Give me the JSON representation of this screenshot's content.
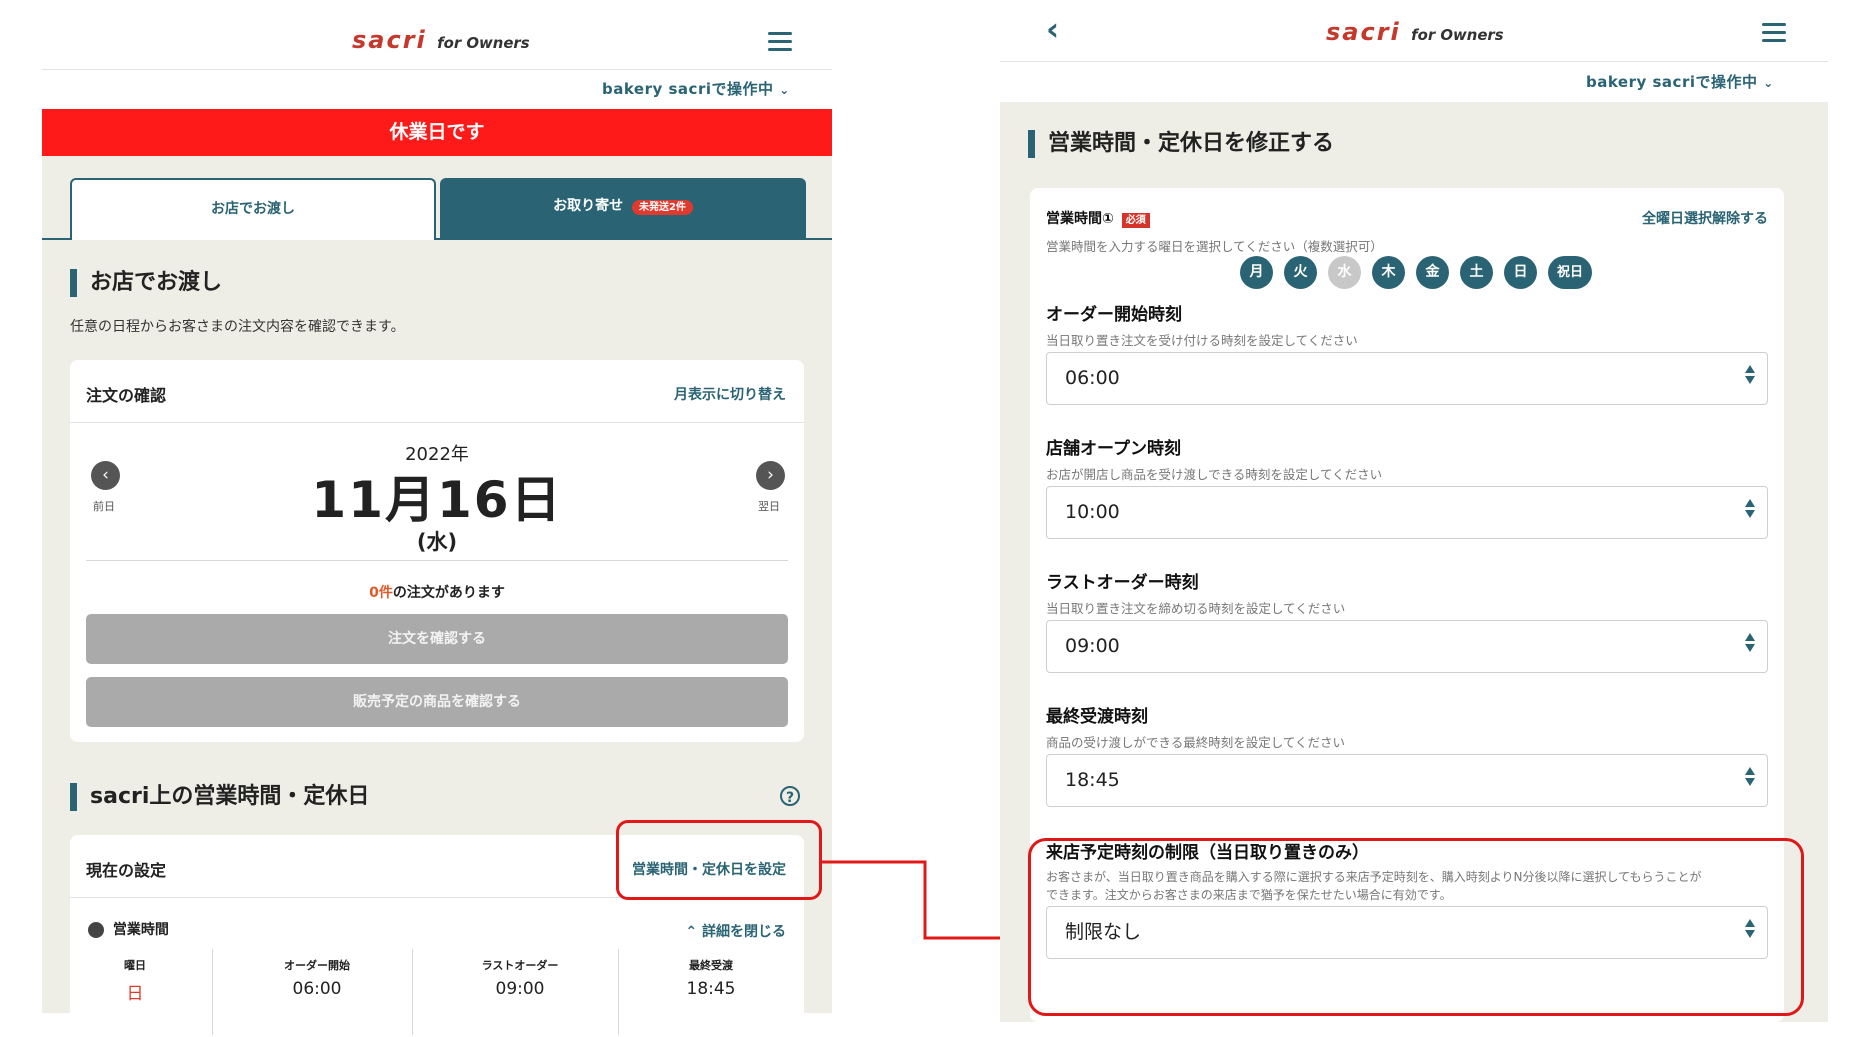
{
  "left": {
    "header": {
      "brand": "sacri",
      "brand_suffix": "for Owners"
    },
    "operating_as": "bakery sacriで操作中",
    "closed_banner": "休業日です",
    "tabs": [
      {
        "label": "お店でお渡し"
      },
      {
        "label": "お取り寄せ",
        "badge": "未発送2件"
      }
    ],
    "section1": {
      "title": "お店でお渡し",
      "description": "任意の日程からお客さまの注文内容を確認できます。"
    },
    "orders_card": {
      "title": "注文の確認",
      "toggle_link": "月表示に切り替え",
      "year": "2022年",
      "date": "11月16日",
      "weekday": "(水)",
      "prev_label": "前日",
      "next_label": "翌日",
      "count": "0件",
      "count_suffix": "の注文があります",
      "confirm_button": "注文を確認する",
      "products_button": "販売予定の商品を確認する"
    },
    "section2": {
      "title": "sacri上の営業時間・定休日"
    },
    "settings_card": {
      "title": "現在の設定",
      "set_link": "営業時間・定休日を設定",
      "hours_label": "営業時間",
      "collapse_link": "詳細を閉じる",
      "columns": [
        "曜日",
        "オーダー開始",
        "ラストオーダー",
        "最終受渡"
      ],
      "row": [
        "日",
        "06:00",
        "09:00",
        "18:45"
      ]
    }
  },
  "right": {
    "header": {
      "brand": "sacri",
      "brand_suffix": "for Owners"
    },
    "operating_as": "bakery sacriで操作中",
    "page_title": "営業時間・定休日を修正する",
    "hours": {
      "label": "営業時間①",
      "required_badge": "必須",
      "clear_all": "全曜日選択解除する",
      "help": "営業時間を入力する曜日を選択してください（複数選択可）",
      "days": [
        {
          "label": "月",
          "selected": true
        },
        {
          "label": "火",
          "selected": true
        },
        {
          "label": "水",
          "selected": false
        },
        {
          "label": "木",
          "selected": true
        },
        {
          "label": "金",
          "selected": true
        },
        {
          "label": "土",
          "selected": true
        },
        {
          "label": "日",
          "selected": true
        },
        {
          "label": "祝日",
          "selected": true
        }
      ]
    },
    "fields": [
      {
        "label": "オーダー開始時刻",
        "help": "当日取り置き注文を受け付ける時刻を設定してください",
        "value": "06:00"
      },
      {
        "label": "店舗オープン時刻",
        "help": "お店が開店し商品を受け渡しできる時刻を設定してください",
        "value": "10:00"
      },
      {
        "label": "ラストオーダー時刻",
        "help": "当日取り置き注文を締め切る時刻を設定してください",
        "value": "09:00"
      },
      {
        "label": "最終受渡時刻",
        "help": "商品の受け渡しができる最終時刻を設定してください",
        "value": "18:45"
      }
    ],
    "restriction": {
      "label": "来店予定時刻の制限（当日取り置きのみ）",
      "help_line1": "お客さまが、当日取り置き商品を購入する際に選択する来店予定時刻を、購入時刻よりN分後以降に選択してもらうことが",
      "help_line2": "できます。注文からお客さまの来店まで猶予を保たせたい場合に有効です。",
      "value": "制限なし"
    }
  },
  "colors": {
    "teal": "#2a6474",
    "banner_red": "#ff1a1a",
    "highlight_red": "#e01818",
    "panel_bg": "#efeee6"
  }
}
